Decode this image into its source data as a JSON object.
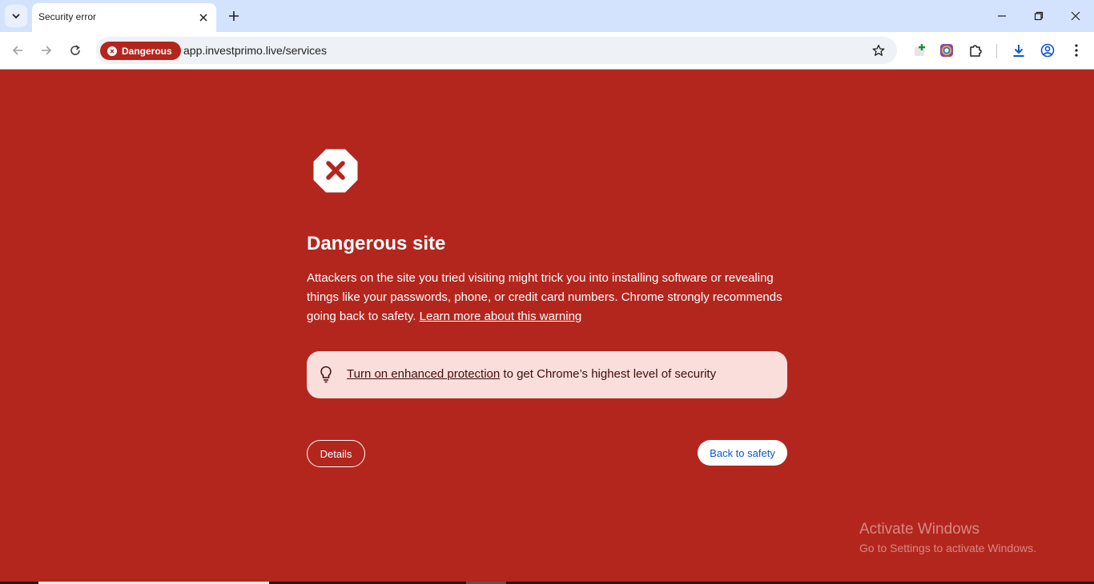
{
  "browser": {
    "tab_title": "Security error",
    "url": "app.investprimo.live/services",
    "security_chip": "Dangerous"
  },
  "interstitial": {
    "heading": "Dangerous site",
    "body": "Attackers on the site you tried visiting might trick you into installing software or revealing things like your passwords, phone, or credit card numbers. Chrome strongly recommends going back to safety.",
    "learn_more": "Learn more about this warning",
    "promo_link": "Turn on enhanced protection",
    "promo_rest": " to get Chrome’s highest level of security",
    "details_button": "Details",
    "back_button": "Back to safety"
  },
  "watermark": {
    "title": "Activate Windows",
    "subtitle": "Go to Settings to activate Windows."
  },
  "colors": {
    "danger_red": "#b3261e",
    "tabstrip": "#d3e3fd",
    "promo_bg": "#f9dedc",
    "link_blue": "#0b57d0"
  },
  "icons": [
    "chevron-down-icon",
    "close-icon",
    "plus-icon",
    "minimize-icon",
    "restore-icon",
    "back-arrow-icon",
    "forward-arrow-icon",
    "reload-icon",
    "star-icon",
    "extension-add-icon",
    "color-extension-icon",
    "puzzle-icon",
    "download-icon",
    "profile-icon",
    "kebab-menu-icon",
    "danger-shield-icon",
    "lightbulb-icon"
  ]
}
